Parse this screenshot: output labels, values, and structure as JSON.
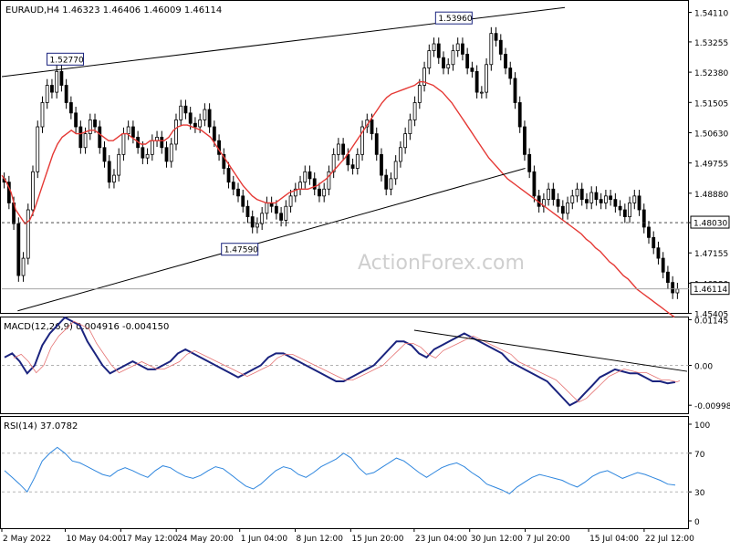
{
  "chart_data": [
    {
      "type": "candlestick",
      "panel": "price",
      "header": "EURAUD,H4  1.46323 1.46406 1.46009 1.46114",
      "watermark": "ActionForex.com",
      "ylim": [
        1.4542,
        1.5444
      ],
      "y_ticks": [
        "1.54110",
        "1.53255",
        "1.52380",
        "1.51505",
        "1.50630",
        "1.49755",
        "1.48880",
        "1.48030",
        "1.47155",
        "1.46280",
        "1.45405"
      ],
      "y_tick_values": [
        1.5411,
        1.53255,
        1.5238,
        1.51505,
        1.5063,
        1.49755,
        1.4888,
        1.4803,
        1.47155,
        1.4628,
        1.45405
      ],
      "price_labels": [
        {
          "text": "1.48030",
          "value": 1.4803,
          "style": "dashed"
        },
        {
          "text": "1.46114",
          "value": 1.46114,
          "style": "solid"
        }
      ],
      "annotations": [
        {
          "text": "1.52770",
          "date": "10 May 2022",
          "value": 1.5277
        },
        {
          "text": "1.53960",
          "date": "28 Jun 2022",
          "value": 1.5396
        },
        {
          "text": "1.47590",
          "date": "1 Jun 2022",
          "value": 1.4759
        }
      ],
      "trendlines": [
        {
          "from": [
            "2 May 2022",
            1.5225
          ],
          "to": [
            "12 Jul 2022",
            1.5425
          ]
        },
        {
          "from": [
            "4 May 2022",
            1.4548
          ],
          "to": [
            "7 Jul 2022",
            1.496
          ]
        }
      ],
      "close": [
        1.492,
        1.486,
        1.48,
        1.465,
        1.47,
        1.484,
        1.495,
        1.508,
        1.515,
        1.52,
        1.518,
        1.524,
        1.52,
        1.515,
        1.512,
        1.508,
        1.502,
        1.506,
        1.51,
        1.508,
        1.502,
        1.498,
        1.492,
        1.494,
        1.5,
        1.506,
        1.508,
        1.505,
        1.502,
        1.499,
        1.5,
        1.504,
        1.505,
        1.502,
        1.498,
        1.503,
        1.51,
        1.514,
        1.512,
        1.509,
        1.508,
        1.51,
        1.513,
        1.508,
        1.504,
        1.5,
        1.496,
        1.492,
        1.49,
        1.488,
        1.485,
        1.482,
        1.479,
        1.48,
        1.483,
        1.486,
        1.485,
        1.483,
        1.481,
        1.485,
        1.488,
        1.49,
        1.492,
        1.495,
        1.493,
        1.49,
        1.488,
        1.49,
        1.495,
        1.5,
        1.503,
        1.5,
        1.497,
        1.496,
        1.5,
        1.508,
        1.51,
        1.506,
        1.5,
        1.494,
        1.49,
        1.493,
        1.498,
        1.502,
        1.506,
        1.51,
        1.515,
        1.52,
        1.525,
        1.53,
        1.532,
        1.528,
        1.525,
        1.526,
        1.53,
        1.532,
        1.529,
        1.525,
        1.524,
        1.518,
        1.518,
        1.526,
        1.535,
        1.533,
        1.529,
        1.525,
        1.522,
        1.515,
        1.508,
        1.5,
        1.495,
        1.488,
        1.485,
        1.487,
        1.49,
        1.487,
        1.485,
        1.483,
        1.486,
        1.488,
        1.49,
        1.487,
        1.486,
        1.489,
        1.487,
        1.486,
        1.488,
        1.487,
        1.485,
        1.484,
        1.482,
        1.486,
        1.488,
        1.484,
        1.479,
        1.476,
        1.473,
        1.47,
        1.466,
        1.463,
        1.46,
        1.4611
      ],
      "ma_line": [
        1.494,
        1.492,
        1.489,
        1.484,
        1.482,
        1.48,
        1.481,
        1.484,
        1.488,
        1.492,
        1.496,
        1.5,
        1.503,
        1.505,
        1.506,
        1.507,
        1.506,
        1.506,
        1.5065,
        1.507,
        1.507,
        1.506,
        1.505,
        1.504,
        1.504,
        1.505,
        1.506,
        1.506,
        1.505,
        1.504,
        1.503,
        1.503,
        1.504,
        1.504,
        1.504,
        1.504,
        1.505,
        1.507,
        1.508,
        1.5085,
        1.5085,
        1.508,
        1.5075,
        1.507,
        1.506,
        1.505,
        1.503,
        1.501,
        1.499,
        1.497,
        1.495,
        1.493,
        1.491,
        1.4895,
        1.488,
        1.487,
        1.4865,
        1.486,
        1.486,
        1.486,
        1.487,
        1.488,
        1.489,
        1.4895,
        1.49,
        1.49,
        1.49,
        1.4905,
        1.491,
        1.492,
        1.493,
        1.4945,
        1.496,
        1.4975,
        1.499,
        1.501,
        1.503,
        1.505,
        1.507,
        1.509,
        1.511,
        1.513,
        1.515,
        1.5165,
        1.5175,
        1.518,
        1.5185,
        1.519,
        1.5195,
        1.52,
        1.521,
        1.521,
        1.5205,
        1.52,
        1.519,
        1.518,
        1.5165,
        1.515,
        1.513,
        1.511,
        1.509,
        1.507,
        1.505,
        1.503,
        1.501,
        1.499,
        1.4975,
        1.496,
        1.4945,
        1.493,
        1.492,
        1.491,
        1.49,
        1.489,
        1.488,
        1.487,
        1.486,
        1.485,
        1.484,
        1.483,
        1.482,
        1.481,
        1.48,
        1.479,
        1.478,
        1.477,
        1.4755,
        1.4745,
        1.473,
        1.472,
        1.4705,
        1.469,
        1.468,
        1.4665,
        1.465,
        1.464,
        1.4625,
        1.461,
        1.46,
        1.459,
        1.458,
        1.457,
        1.456,
        1.455,
        1.454,
        1.453
      ],
      "x_ticks": [
        "2 May 2022",
        "10 May 04:00",
        "17 May 12:00",
        "24 May 20:00",
        "1 Jun 04:00",
        "8 Jun 12:00",
        "15 Jun 20:00",
        "23 Jun 04:00",
        "30 Jun 12:00",
        "7 Jul 20:00",
        "15 Jul 04:00",
        "22 Jul 12:00"
      ],
      "grid": false
    },
    {
      "type": "line",
      "panel": "macd",
      "header": "MACD(12,26,9) 0.004916 -0.004150",
      "ylim": [
        -0.012,
        0.012
      ],
      "y_ticks": [
        "0.01145",
        "0.00",
        "-0.009985"
      ],
      "level_lines": [
        0.0
      ],
      "series": [
        {
          "name": "MACD",
          "color": "#1a237e",
          "values": [
            0.002,
            0.003,
            0.001,
            -0.002,
            0.0,
            0.005,
            0.008,
            0.01,
            0.012,
            0.011,
            0.01,
            0.006,
            0.003,
            0.0,
            -0.002,
            -0.001,
            0.0,
            0.001,
            0.0,
            -0.001,
            -0.001,
            0.0,
            0.001,
            0.003,
            0.004,
            0.003,
            0.002,
            0.001,
            0.0,
            -0.001,
            -0.002,
            -0.003,
            -0.002,
            -0.001,
            0.0,
            0.002,
            0.003,
            0.003,
            0.002,
            0.001,
            0.0,
            -0.001,
            -0.002,
            -0.003,
            -0.004,
            -0.004,
            -0.003,
            -0.002,
            -0.001,
            0.0,
            0.002,
            0.004,
            0.006,
            0.006,
            0.005,
            0.003,
            0.002,
            0.004,
            0.005,
            0.006,
            0.007,
            0.008,
            0.007,
            0.006,
            0.005,
            0.004,
            0.003,
            0.001,
            0.0,
            -0.001,
            -0.002,
            -0.003,
            -0.004,
            -0.006,
            -0.008,
            -0.01,
            -0.009,
            -0.007,
            -0.005,
            -0.003,
            -0.002,
            -0.001,
            -0.0015,
            -0.002,
            -0.002,
            -0.003,
            -0.004,
            -0.004,
            -0.0045,
            -0.0042
          ]
        }
      ]
    },
    {
      "type": "line",
      "panel": "rsi",
      "header": "RSI(14) 37.0782",
      "ylim": [
        0,
        100
      ],
      "y_ticks": [
        "100",
        "70",
        "30",
        "0"
      ],
      "level_lines": [
        70,
        30
      ],
      "series": [
        {
          "name": "RSI",
          "color": "#2e86de",
          "values": [
            52,
            45,
            38,
            30,
            45,
            62,
            70,
            76,
            70,
            62,
            60,
            56,
            52,
            48,
            46,
            52,
            55,
            52,
            48,
            45,
            52,
            57,
            55,
            50,
            46,
            44,
            47,
            52,
            56,
            54,
            48,
            42,
            36,
            33,
            38,
            45,
            52,
            56,
            54,
            48,
            45,
            50,
            56,
            60,
            64,
            70,
            65,
            55,
            48,
            50,
            55,
            60,
            65,
            62,
            56,
            50,
            45,
            50,
            55,
            58,
            60,
            56,
            50,
            45,
            38,
            35,
            32,
            28,
            35,
            40,
            45,
            48,
            46,
            44,
            42,
            38,
            35,
            40,
            46,
            50,
            52,
            48,
            44,
            47,
            50,
            48,
            45,
            42,
            38,
            37
          ]
        }
      ]
    }
  ]
}
